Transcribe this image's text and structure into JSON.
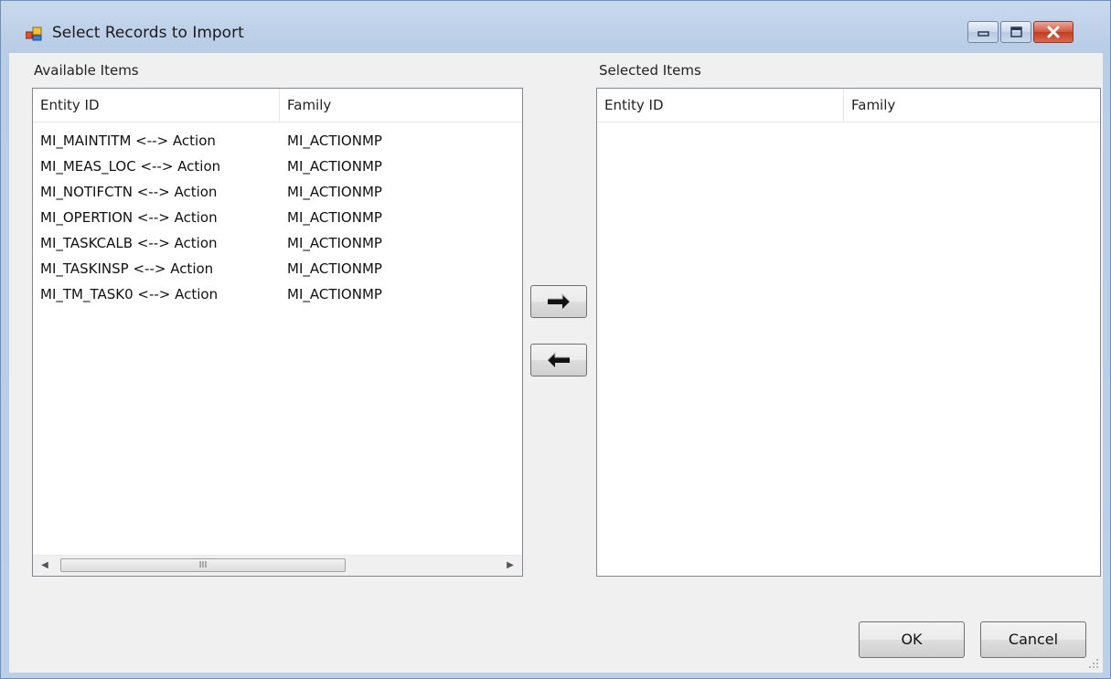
{
  "window": {
    "title": "Select Records to Import"
  },
  "caption_buttons": {
    "minimize": "▭",
    "maximize": "▢",
    "close": "✕"
  },
  "available": {
    "label": "Available Items",
    "columns": [
      "Entity ID",
      "Family"
    ],
    "rows": [
      [
        "MI_MAINTITM <--> Action",
        "MI_ACTIONMP"
      ],
      [
        "MI_MEAS_LOC <--> Action",
        "MI_ACTIONMP"
      ],
      [
        "MI_NOTIFCTN <--> Action",
        "MI_ACTIONMP"
      ],
      [
        "MI_OPERTION <--> Action",
        "MI_ACTIONMP"
      ],
      [
        "MI_TASKCALB <--> Action",
        "MI_ACTIONMP"
      ],
      [
        "MI_TASKINSP <--> Action",
        "MI_ACTIONMP"
      ],
      [
        "MI_TM_TASK0 <--> Action",
        "MI_ACTIONMP"
      ]
    ],
    "scroll_thumb_glyph": "III"
  },
  "selected": {
    "label": "Selected Items",
    "columns": [
      "Entity ID",
      "Family"
    ],
    "rows": []
  },
  "icons": {
    "app": "app-window-icon",
    "move_right": "arrow-right-icon",
    "move_left": "arrow-left-icon"
  },
  "buttons": {
    "ok": "OK",
    "cancel": "Cancel"
  }
}
